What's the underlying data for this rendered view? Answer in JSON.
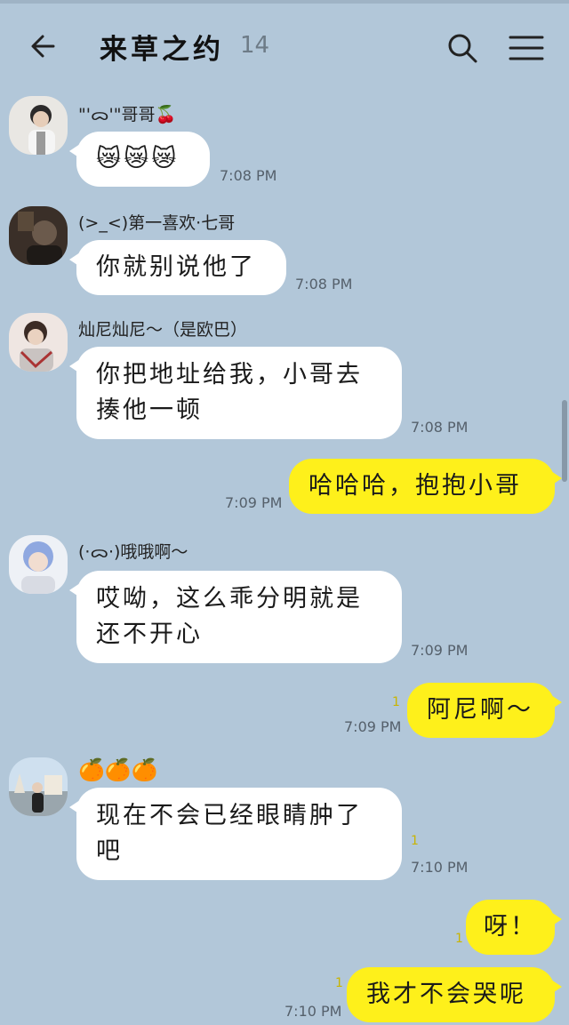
{
  "header": {
    "title": "来草之约",
    "member_count": "14"
  },
  "messages": [
    {
      "sender": "\"'ᯅ'\"哥哥🍒",
      "text": "😿😿😿",
      "time": "7:08 PM"
    },
    {
      "sender": "(>_<)第一喜欢·七哥",
      "text": "你就别说他了",
      "time": "7:08 PM"
    },
    {
      "sender": "灿尼灿尼～（是欧巴）",
      "line1": "你把地址给我，小哥去",
      "line2": "揍他一顿",
      "time": "7:08 PM"
    },
    {
      "text": "哈哈哈，抱抱小哥",
      "time": "7:09 PM"
    },
    {
      "sender": "(·ᯅ·)哦哦啊～",
      "line1": "哎呦，这么乖分明就是",
      "line2": "还不开心",
      "time": "7:09 PM"
    },
    {
      "text": "阿尼啊～",
      "time": "7:09 PM"
    },
    {
      "sender": "🍊🍊🍊",
      "line1": "现在不会已经眼睛肿了",
      "line2": "吧",
      "time": "7:10 PM"
    },
    {
      "text": "呀！"
    },
    {
      "text": "我才不会哭呢",
      "time": "7:10 PM"
    }
  ],
  "read_mark": "1",
  "icons": {
    "back": "arrow-left-icon",
    "search": "search-icon",
    "menu": "hamburger-menu-icon"
  },
  "colors": {
    "background": "#b2c7d9",
    "outgoing_bubble": "#fef01b",
    "incoming_bubble": "#ffffff"
  }
}
